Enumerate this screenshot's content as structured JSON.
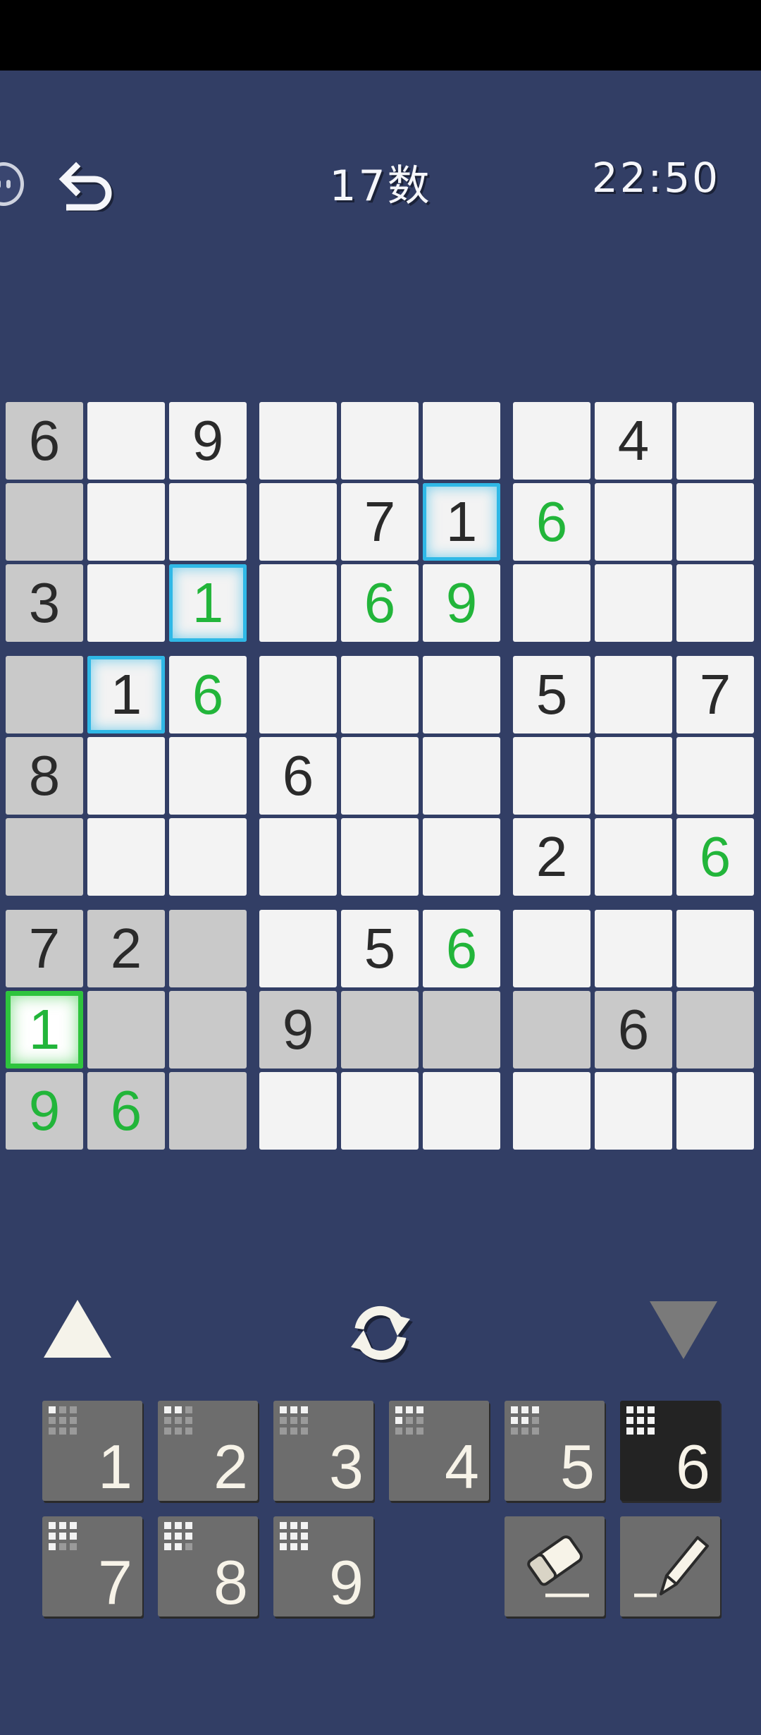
{
  "header": {
    "title": "17数",
    "timer": "22:50"
  },
  "board": {
    "cells": [
      [
        "6",
        "",
        "9",
        "",
        "",
        "",
        "",
        "4",
        ""
      ],
      [
        "",
        "",
        "",
        "",
        "7",
        "1",
        "6",
        "",
        ""
      ],
      [
        "3",
        "",
        "1",
        "",
        "6",
        "9",
        "",
        "",
        ""
      ],
      [
        "",
        "1",
        "6",
        "",
        "",
        "",
        "5",
        "",
        "7"
      ],
      [
        "8",
        "",
        "",
        "6",
        "",
        "",
        "",
        "",
        ""
      ],
      [
        "",
        "",
        "",
        "",
        "",
        "",
        "2",
        "",
        "6"
      ],
      [
        "7",
        "2",
        "",
        "",
        "5",
        "6",
        "",
        "",
        ""
      ],
      [
        "1",
        "",
        "",
        "9",
        "",
        "",
        "",
        "6",
        ""
      ],
      [
        "9",
        "6",
        "",
        "",
        "",
        "",
        "",
        "",
        ""
      ]
    ],
    "user_entries": [
      [
        1,
        6
      ],
      [
        2,
        2
      ],
      [
        2,
        4
      ],
      [
        2,
        5
      ],
      [
        3,
        2
      ],
      [
        5,
        8
      ],
      [
        6,
        5
      ],
      [
        7,
        0
      ],
      [
        8,
        0
      ],
      [
        8,
        1
      ]
    ],
    "gray_cells": [
      [
        0,
        0
      ],
      [
        1,
        0
      ],
      [
        2,
        0
      ],
      [
        3,
        0
      ],
      [
        4,
        0
      ],
      [
        5,
        0
      ],
      [
        6,
        0
      ],
      [
        6,
        1
      ],
      [
        6,
        2
      ],
      [
        7,
        1
      ],
      [
        7,
        2
      ],
      [
        7,
        3
      ],
      [
        7,
        4
      ],
      [
        7,
        5
      ],
      [
        7,
        6
      ],
      [
        7,
        7
      ],
      [
        7,
        8
      ],
      [
        8,
        0
      ],
      [
        8,
        1
      ],
      [
        8,
        2
      ]
    ],
    "highlight_blue": [
      [
        1,
        5
      ],
      [
        2,
        2
      ],
      [
        3,
        1
      ]
    ],
    "highlight_green": [
      [
        7,
        0
      ]
    ],
    "colors": {
      "given_digit": "#2a2a2a",
      "user_digit": "#22b53a",
      "cell_white": "#f3f3f3",
      "cell_gray": "#c9c9c9",
      "highlight_blue": "#2fb8e6",
      "highlight_green": "#2ec43d"
    }
  },
  "controls": {
    "prev_icon": "triangle-up-icon",
    "refresh_icon": "refresh-icon",
    "next_icon": "triangle-down-icon"
  },
  "keypad": {
    "keys": [
      {
        "label": "1",
        "filled": 1
      },
      {
        "label": "2",
        "filled": 2
      },
      {
        "label": "3",
        "filled": 3
      },
      {
        "label": "4",
        "filled": 4
      },
      {
        "label": "5",
        "filled": 5
      },
      {
        "label": "6",
        "filled": 9,
        "active": true
      },
      {
        "label": "7",
        "filled": 7
      },
      {
        "label": "8",
        "filled": 8
      },
      {
        "label": "9",
        "filled": 9
      }
    ],
    "eraser_icon": "eraser-icon",
    "pencil_icon": "pencil-icon"
  }
}
